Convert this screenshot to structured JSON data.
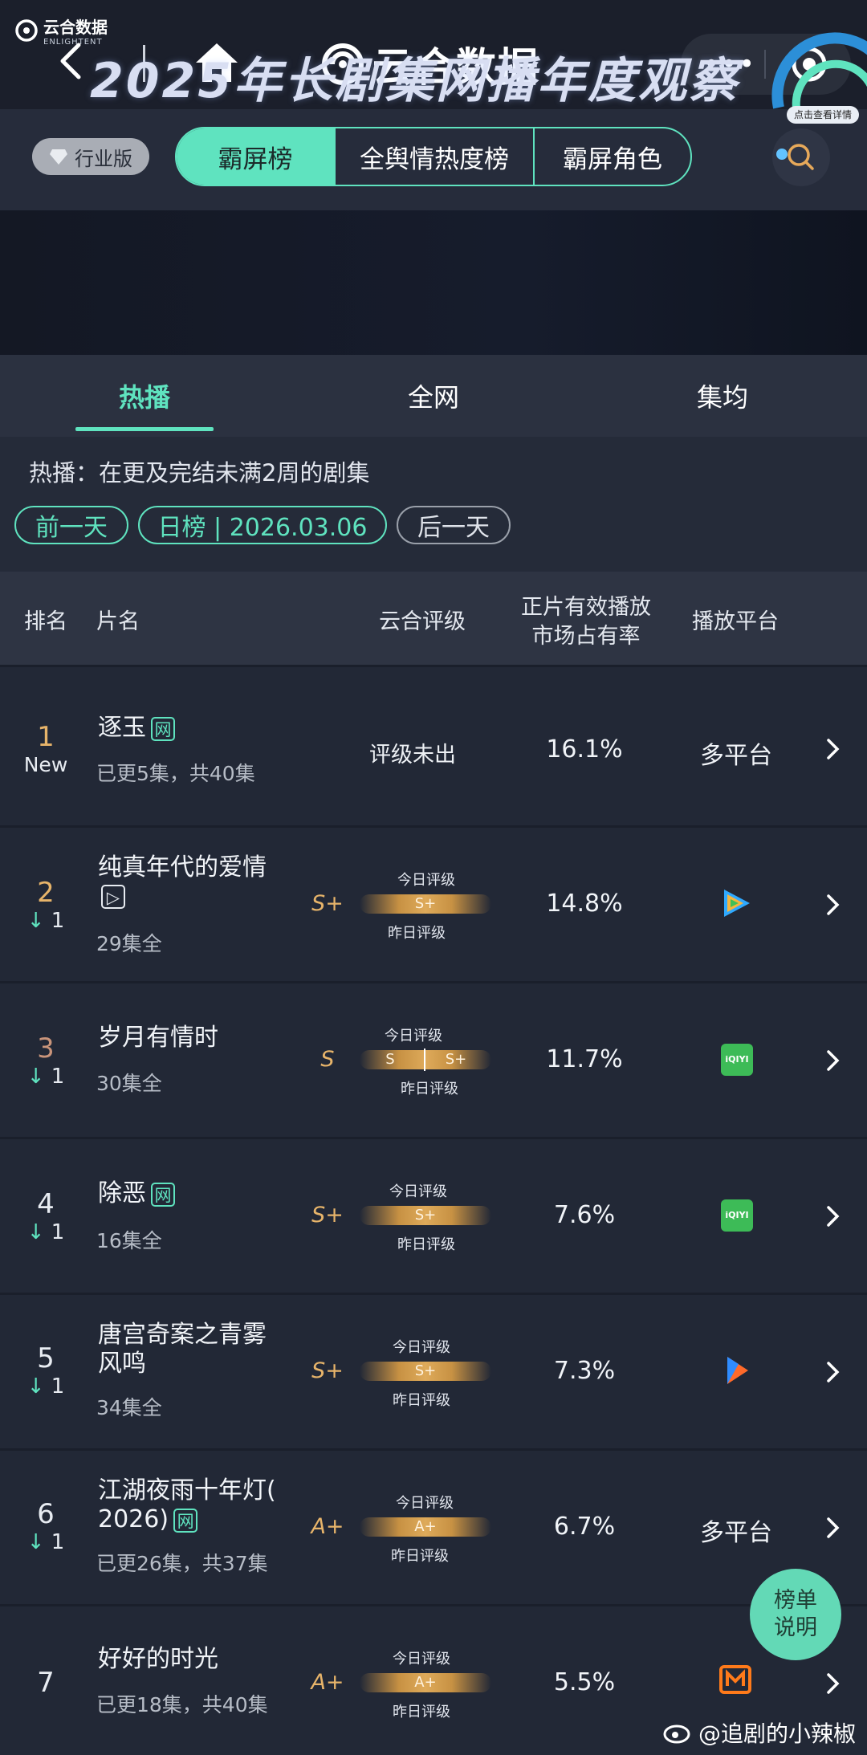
{
  "header": {
    "brand": "云合数据"
  },
  "nav": {
    "industry_label": "行业版",
    "segments": [
      "霸屏榜",
      "全舆情热度榜",
      "霸屏角色"
    ]
  },
  "banner": {
    "logo_cn": "云合数据",
    "logo_en": "ENLIGHTENT",
    "title": "2025年长剧集网播年度观察",
    "button": "点击查看详情"
  },
  "tabs": [
    "热播",
    "全网",
    "集均"
  ],
  "description": "热播：在更及完结未满2周的剧集",
  "date_nav": {
    "prev": "前一天",
    "current": "日榜 | 2026.03.06",
    "next": "后一天"
  },
  "table": {
    "headers": {
      "rank": "排名",
      "name": "片名",
      "grade": "云合评级",
      "share_l1": "正片有效播放",
      "share_l2": "市场占有率",
      "platform": "播放平台"
    },
    "today_label": "今日评级",
    "yesterday_label": "昨日评级",
    "rows": [
      {
        "rank": "1",
        "change": "New",
        "title": "逐玉",
        "title2": "",
        "tag": "网",
        "episodes": "已更5集，共40集",
        "grade": "",
        "grade_text": "评级未出",
        "share": "16.1%",
        "platform": "多平台",
        "platform_icon": ""
      },
      {
        "rank": "2",
        "change": "1",
        "title": "纯真年代的爱情",
        "title2": "",
        "tag": "▷",
        "episodes": "29集全",
        "grade": "S+",
        "today": "S+",
        "share": "14.8%",
        "platform": "",
        "platform_icon": "tencent-video-icon"
      },
      {
        "rank": "3",
        "change": "1",
        "title": "岁月有情时",
        "title2": "",
        "tag": "",
        "episodes": "30集全",
        "grade": "S",
        "today": "S",
        "yesterday": "S+",
        "share": "11.7%",
        "platform": "",
        "platform_icon": "iqiyi-icon"
      },
      {
        "rank": "4",
        "change": "1",
        "title": "除恶",
        "title2": "",
        "tag": "网",
        "episodes": "16集全",
        "grade": "S+",
        "today": "S+",
        "share": "7.6%",
        "platform": "",
        "platform_icon": "iqiyi-icon"
      },
      {
        "rank": "5",
        "change": "1",
        "title": "唐宫奇案之青雾",
        "title2": "风鸣",
        "tag": "",
        "episodes": "34集全",
        "grade": "S+",
        "today": "S+",
        "share": "7.3%",
        "platform": "",
        "platform_icon": "youku-icon"
      },
      {
        "rank": "6",
        "change": "1",
        "title": "江湖夜雨十年灯(",
        "title2": "2026)",
        "tag": "网",
        "episodes": "已更26集，共37集",
        "grade": "A+",
        "today": "A+",
        "share": "6.7%",
        "platform": "多平台",
        "platform_icon": ""
      },
      {
        "rank": "7",
        "change": "",
        "title": "好好的时光",
        "title2": "",
        "tag": "",
        "episodes": "已更18集，共40集",
        "grade": "A+",
        "today": "A+",
        "share": "5.5%",
        "platform": "",
        "platform_icon": "mango-tv-icon"
      }
    ]
  },
  "fab": {
    "line1": "榜单",
    "line2": "说明"
  },
  "watermark": {
    "user": "@追剧的小辣椒"
  },
  "colors": {
    "accent": "#5fe3bf",
    "grade": "#e7b46a",
    "down": "#5fe3bf",
    "rank1": "#e7b46a"
  }
}
